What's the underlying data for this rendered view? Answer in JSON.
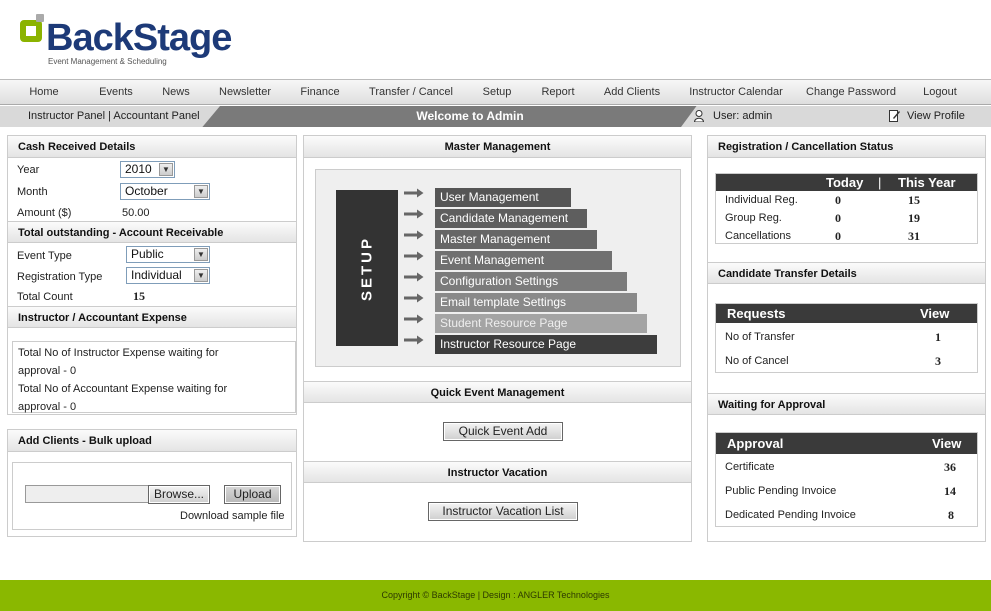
{
  "brand": {
    "name": "BackStage",
    "tagline": "Event Management & Scheduling"
  },
  "nav": [
    "Home",
    "Events",
    "News",
    "Newsletter",
    "Finance",
    "Transfer / Cancel",
    "Setup",
    "Report",
    "Add Clients",
    "Instructor Calendar",
    "Change Password",
    "Logout"
  ],
  "subbar": {
    "panels": "Instructor Panel | Accountant Panel",
    "welcome": "Welcome to Admin",
    "user": "User: admin",
    "view_profile": "View Profile"
  },
  "cash": {
    "title": "Cash Received Details",
    "year_label": "Year",
    "year_value": "2010",
    "month_label": "Month",
    "month_value": "October",
    "amount_label": "Amount ($)",
    "amount_value": "50.00"
  },
  "outstanding": {
    "title": "Total outstanding - Account Receivable",
    "event_type_label": "Event Type",
    "event_type_value": "Public",
    "reg_type_label": "Registration Type",
    "reg_type_value": "Individual",
    "total_label": "Total Count",
    "total_value": "15"
  },
  "expense": {
    "title": "Instructor / Accountant Expense",
    "line1": "Total No of Instructor Expense waiting for",
    "line2": "approval - 0",
    "line3": "Total No of Accountant Expense waiting for",
    "line4": "approval - 0"
  },
  "bulk": {
    "title": "Add Clients - Bulk upload",
    "browse": "Browse...",
    "upload": "Upload",
    "sample": "Download sample file"
  },
  "master": {
    "title": "Master Management",
    "setup_label": "SETUP",
    "items": [
      "User Management",
      "Candidate Management",
      "Master Management",
      "Event Management",
      "Configuration Settings",
      "Email template Settings",
      "Student Resource Page",
      "Instructor Resource Page"
    ]
  },
  "quick": {
    "title": "Quick Event Management",
    "button": "Quick Event Add"
  },
  "vacation": {
    "title": "Instructor Vacation",
    "button": "Instructor Vacation List"
  },
  "regstatus": {
    "title": "Registration / Cancellation Status",
    "col_today": "Today",
    "col_year": "This Year",
    "rows": [
      {
        "label": "Individual Reg.",
        "today": "0",
        "year": "15"
      },
      {
        "label": "Group Reg.",
        "today": "0",
        "year": "19"
      },
      {
        "label": "Cancellations",
        "today": "0",
        "year": "31"
      }
    ]
  },
  "transfer": {
    "title": "Candidate Transfer Details",
    "col_req": "Requests",
    "col_view": "View",
    "rows": [
      {
        "label": "No of Transfer",
        "value": "1"
      },
      {
        "label": "No of Cancel",
        "value": "3"
      }
    ]
  },
  "approval": {
    "title": "Waiting for Approval",
    "col_app": "Approval",
    "col_view": "View",
    "rows": [
      {
        "label": "Certificate",
        "value": "36"
      },
      {
        "label": "Public Pending Invoice",
        "value": "14"
      },
      {
        "label": "Dedicated Pending Invoice",
        "value": "8"
      }
    ]
  },
  "footer": "Copyright © BackStage | Design : ANGLER Technologies"
}
